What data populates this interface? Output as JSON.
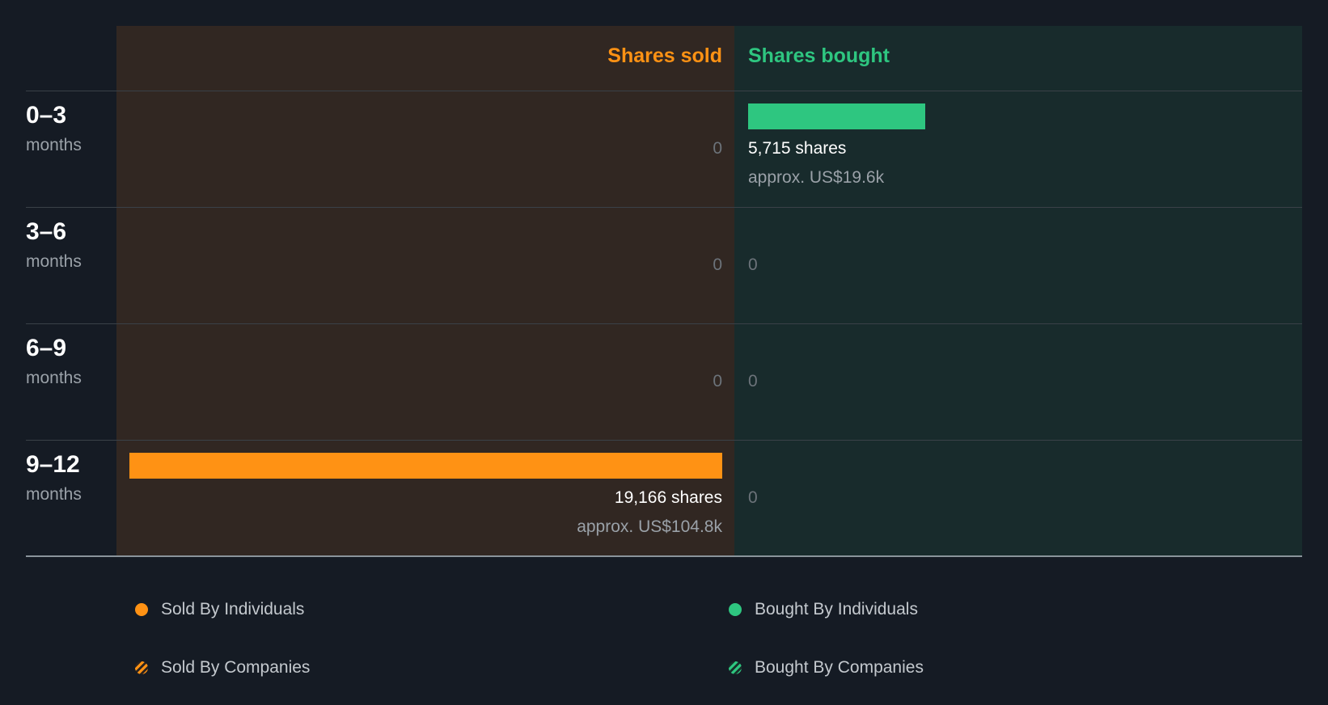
{
  "chart_data": {
    "type": "bar",
    "headers": {
      "sold": "Shares sold",
      "bought": "Shares bought"
    },
    "max_shares": 19166,
    "rows": [
      {
        "range": "0–3",
        "unit": "months",
        "sold": {
          "shares": 0,
          "label": "0",
          "approx": ""
        },
        "bought": {
          "shares": 5715,
          "label": "5,715 shares",
          "approx": "approx. US$19.6k"
        }
      },
      {
        "range": "3–6",
        "unit": "months",
        "sold": {
          "shares": 0,
          "label": "0",
          "approx": ""
        },
        "bought": {
          "shares": 0,
          "label": "0",
          "approx": ""
        }
      },
      {
        "range": "6–9",
        "unit": "months",
        "sold": {
          "shares": 0,
          "label": "0",
          "approx": ""
        },
        "bought": {
          "shares": 0,
          "label": "0",
          "approx": ""
        }
      },
      {
        "range": "9–12",
        "unit": "months",
        "sold": {
          "shares": 19166,
          "label": "19,166 shares",
          "approx": "approx. US$104.8k"
        },
        "bought": {
          "shares": 0,
          "label": "0",
          "approx": ""
        }
      }
    ],
    "legend": [
      {
        "label": "Sold By Individuals",
        "style": "solid",
        "color": "#ff9214"
      },
      {
        "label": "Bought By Individuals",
        "style": "solid",
        "color": "#2ec680"
      },
      {
        "label": "Sold By Companies",
        "style": "hatched",
        "color": "#ff9214"
      },
      {
        "label": "Bought By Companies",
        "style": "hatched",
        "color": "#2ec680"
      }
    ],
    "colors": {
      "sold": "#ff9214",
      "bought": "#2ec680",
      "background": "#151b24",
      "sold_panel": "#312722",
      "bought_panel": "#182b2c"
    }
  }
}
